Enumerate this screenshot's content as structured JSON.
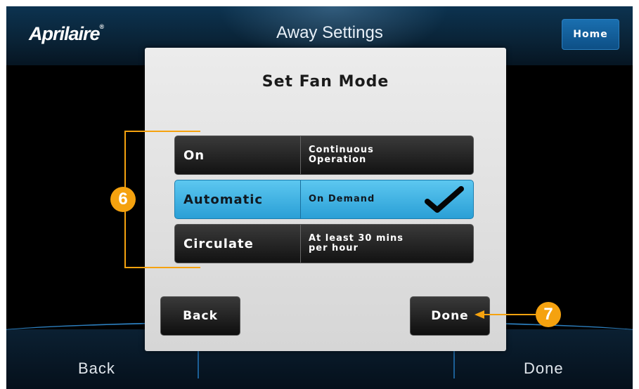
{
  "header": {
    "logo_text": "Aprilaire",
    "logo_mark": "®",
    "title": "Away Settings",
    "home_label": "Home"
  },
  "footer": {
    "back_label": "Back",
    "done_label": "Done"
  },
  "modal": {
    "title": "Set Fan Mode",
    "options": [
      {
        "name": "On",
        "desc_line1": "Continuous",
        "desc_line2": "Operation",
        "selected": false
      },
      {
        "name": "Automatic",
        "desc_line1": "On Demand",
        "desc_line2": "",
        "selected": true
      },
      {
        "name": "Circulate",
        "desc_line1": "At least 30 mins",
        "desc_line2": "per hour",
        "selected": false
      }
    ],
    "back_label": "Back",
    "done_label": "Done"
  },
  "callouts": {
    "options_marker": "6",
    "done_marker": "7"
  },
  "colors": {
    "accent_orange": "#f5a20f",
    "selected_blue": "#3db3e6",
    "home_blue": "#1a6fb0"
  },
  "icons": [
    "checkmark-icon",
    "arrow-left-icon"
  ]
}
